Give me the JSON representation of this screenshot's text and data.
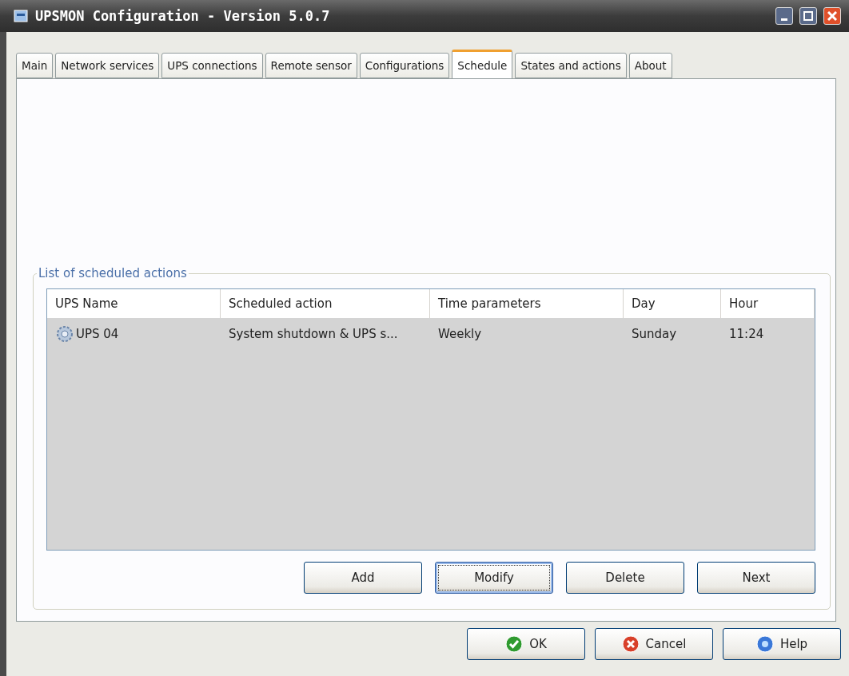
{
  "window": {
    "title": "UPSMON Configuration - Version 5.0.7"
  },
  "tabs": [
    {
      "label": "Main",
      "selected": false
    },
    {
      "label": "Network services",
      "selected": false
    },
    {
      "label": "UPS connections",
      "selected": false
    },
    {
      "label": "Remote sensor",
      "selected": false
    },
    {
      "label": "Configurations",
      "selected": false
    },
    {
      "label": "Schedule",
      "selected": true
    },
    {
      "label": "States and actions",
      "selected": false
    },
    {
      "label": "About",
      "selected": false
    }
  ],
  "group": {
    "title": "List of scheduled actions",
    "table": {
      "columns": [
        "UPS Name",
        "Scheduled action",
        "Time parameters",
        "Day",
        "Hour"
      ],
      "rows": [
        [
          "UPS 04",
          "System shutdown & UPS s...",
          "Weekly",
          "Sunday",
          "11:24"
        ]
      ]
    },
    "buttons": [
      {
        "label": "Add",
        "focused": false
      },
      {
        "label": "Modify",
        "focused": true
      },
      {
        "label": "Delete",
        "focused": false
      },
      {
        "label": "Next",
        "focused": false
      }
    ]
  },
  "dialog_buttons": [
    {
      "label": "OK",
      "kind": "ok"
    },
    {
      "label": "Cancel",
      "kind": "cancel"
    },
    {
      "label": "Help",
      "kind": "help"
    }
  ]
}
